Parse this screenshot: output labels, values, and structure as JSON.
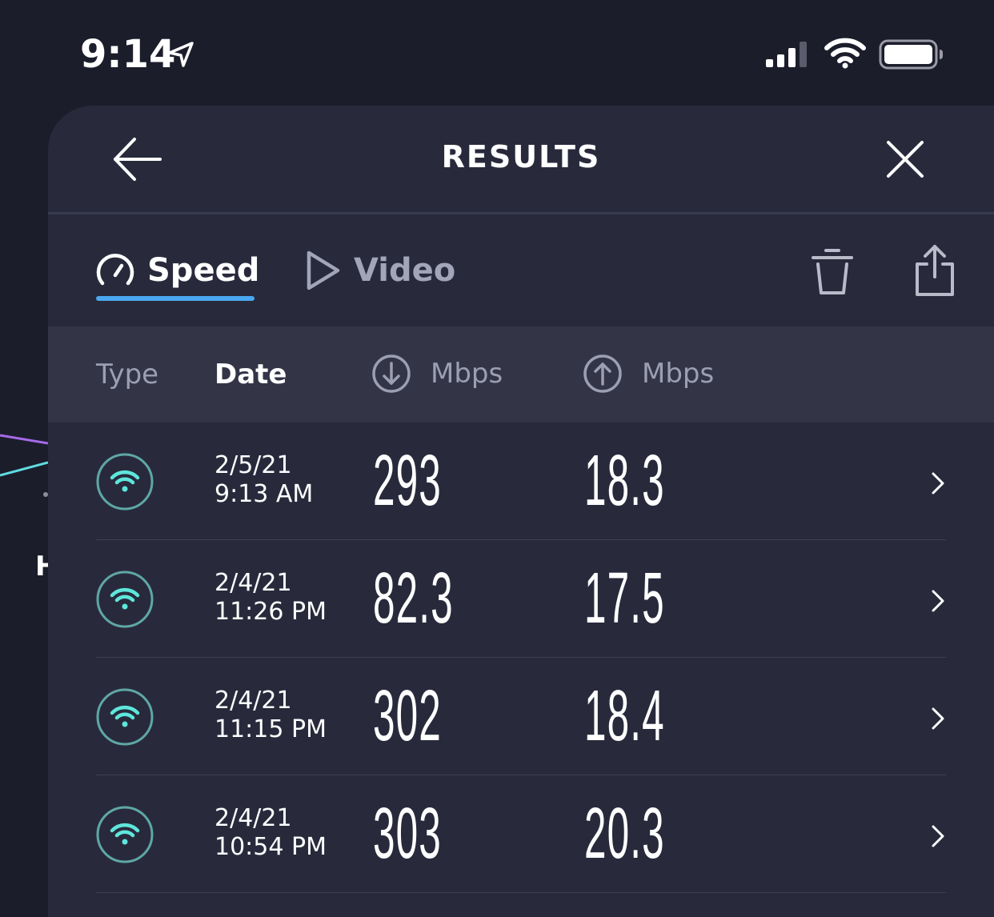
{
  "status_bar": {
    "time": "9:14",
    "icons": [
      "location-arrow-icon",
      "cellular-signal-icon",
      "wifi-icon",
      "battery-icon"
    ]
  },
  "background": {
    "partial_letter": "H"
  },
  "header": {
    "title": "RESULTS",
    "back_icon": "back-arrow-icon",
    "close_icon": "close-icon"
  },
  "tabs": [
    {
      "label": "Speed",
      "icon": "speedometer-icon",
      "selected": true
    },
    {
      "label": "Video",
      "icon": "play-icon",
      "selected": false
    }
  ],
  "toolbar": {
    "delete_icon": "trash-icon",
    "share_icon": "share-icon"
  },
  "columns": {
    "type": "Type",
    "date": "Date",
    "download": "Mbps",
    "upload": "Mbps"
  },
  "results": [
    {
      "type": "wifi",
      "date": "2/5/21",
      "time": "9:13 AM",
      "download": "293",
      "upload": "18.3"
    },
    {
      "type": "wifi",
      "date": "2/4/21",
      "time": "11:26 PM",
      "download": "82.3",
      "upload": "17.5"
    },
    {
      "type": "wifi",
      "date": "2/4/21",
      "time": "11:15 PM",
      "download": "302",
      "upload": "18.4"
    },
    {
      "type": "wifi",
      "date": "2/4/21",
      "time": "10:54 PM",
      "download": "303",
      "upload": "20.3"
    }
  ],
  "colors": {
    "background": "#1b1d2b",
    "sheet": "#282a3c",
    "column_header": "#333547",
    "accent_tab": "#4aa8f0",
    "wifi_icon": "#5ee6dc",
    "wifi_ring": "#5fa7a4",
    "muted_text": "#9c9eb1"
  }
}
